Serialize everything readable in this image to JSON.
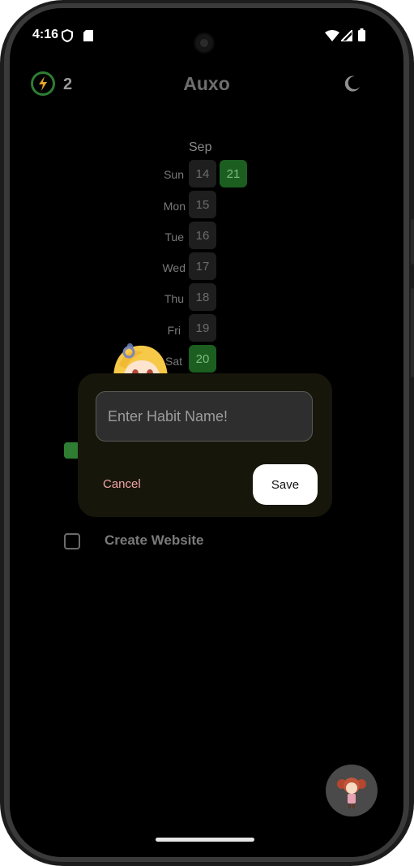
{
  "status_bar": {
    "time": "4:16"
  },
  "app_bar": {
    "streak_count": "2",
    "title": "Auxo"
  },
  "calendar": {
    "month": "Sep",
    "weekdays": [
      "Sun",
      "Mon",
      "Tue",
      "Wed",
      "Thu",
      "Fri",
      "Sat"
    ],
    "dates": [
      {
        "date": "14",
        "completed": false
      },
      {
        "date": "21",
        "completed": true
      },
      {
        "date": "15",
        "completed": false
      },
      {
        "date": "16",
        "completed": false
      },
      {
        "date": "17",
        "completed": false
      },
      {
        "date": "18",
        "completed": false
      },
      {
        "date": "19",
        "completed": false
      },
      {
        "date": "20",
        "completed": true
      }
    ]
  },
  "habits": [
    {
      "label": "",
      "checked": true
    },
    {
      "label": "Create Website",
      "checked": false
    }
  ],
  "dialog": {
    "input_placeholder": "Enter Habit Name!",
    "input_value": "",
    "cancel_label": "Cancel",
    "save_label": "Save"
  },
  "colors": {
    "accent_green": "#2e7d32",
    "completed_cell": "#1b5e20",
    "dialog_bg": "#17160a",
    "cancel_text": "#f0a6a6"
  },
  "icons": {
    "streak": "lightning-icon",
    "theme": "moon-icon",
    "fab": "mascot-avatar-icon"
  }
}
